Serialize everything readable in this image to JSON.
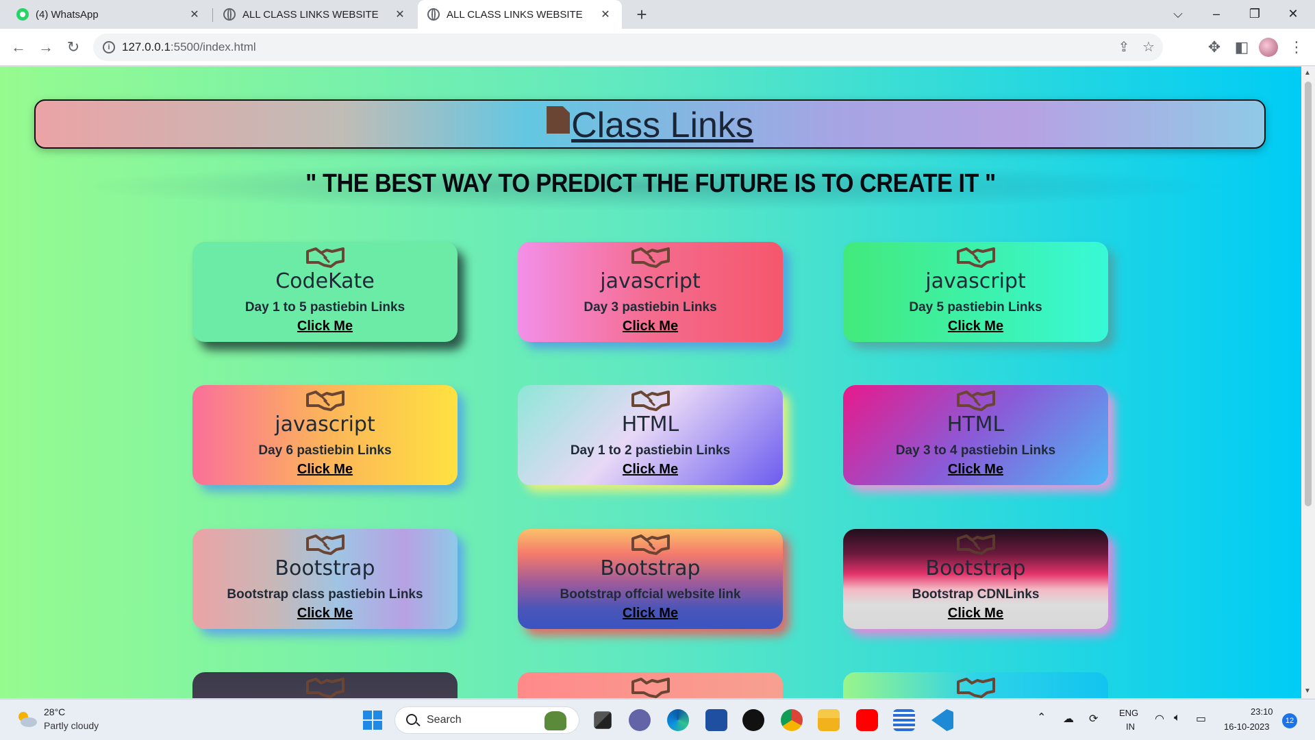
{
  "browser": {
    "tabs": [
      {
        "title": "(4) WhatsApp",
        "icon": "whatsapp-icon",
        "active": false
      },
      {
        "title": "ALL CLASS LINKS WEBSITE",
        "icon": "globe-icon",
        "active": false
      },
      {
        "title": "ALL CLASS LINKS WEBSITE",
        "icon": "globe-icon",
        "active": true
      }
    ],
    "close_glyph": "✕",
    "new_tab_glyph": "+",
    "url_host": "127.0.0.1",
    "url_rest": ":5500/index.html"
  },
  "page": {
    "header_title": "Class Links",
    "quote": "\" THE BEST WAY TO PREDICT THE FUTURE IS TO CREATE IT \"",
    "cards": [
      {
        "title": "CodeKate",
        "desc": "Day 1 to 5 pastiebin Links",
        "link": "Click Me"
      },
      {
        "title": "javascript",
        "desc": "Day 3 pastiebin Links",
        "link": "Click Me"
      },
      {
        "title": "javascript",
        "desc": "Day 5 pastiebin Links",
        "link": "Click Me"
      },
      {
        "title": "javascript",
        "desc": "Day 6 pastiebin Links",
        "link": "Click Me"
      },
      {
        "title": "HTML",
        "desc": "Day 1 to 2 pastiebin Links",
        "link": "Click Me"
      },
      {
        "title": "HTML",
        "desc": "Day 3 to 4 pastiebin Links",
        "link": "Click Me"
      },
      {
        "title": "Bootstrap",
        "desc": "Bootstrap class pastiebin Links",
        "link": "Click Me"
      },
      {
        "title": "Bootstrap",
        "desc": "Bootstrap offcial website link",
        "link": "Click Me"
      },
      {
        "title": "Bootstrap",
        "desc": "Bootstrap CDNLinks",
        "link": "Click Me"
      }
    ]
  },
  "taskbar": {
    "weather_temp": "28°C",
    "weather_desc": "Partly cloudy",
    "search_label": "Search",
    "lang_line1": "ENG",
    "lang_line2": "IN",
    "time": "23:10",
    "date": "16-10-2023",
    "notifications": "12"
  }
}
